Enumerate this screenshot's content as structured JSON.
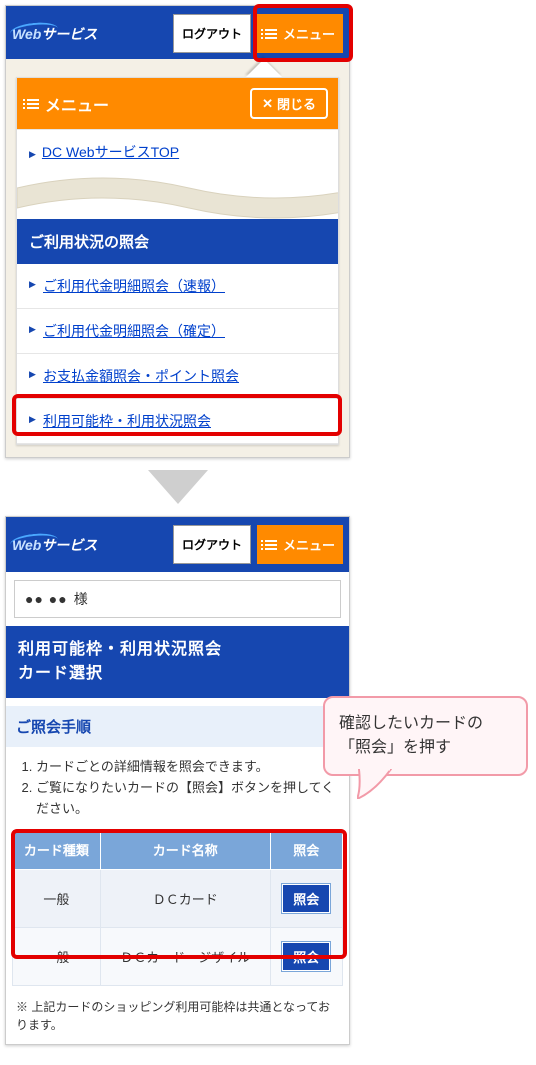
{
  "logo_web": "Web",
  "logo_svc": "サービス",
  "logout": "ログアウト",
  "menu": "メニュー",
  "close": "閉じる",
  "menu_top": "DC WebサービスTOP",
  "sec_usage": "ご利用状況の照会",
  "usage_links": [
    "ご利用代金明細照会（速報）",
    "ご利用代金明細照会（確定）",
    "お支払金額照会・ポイント照会",
    "利用可能枠・利用状況照会"
  ],
  "greet_suffix": "様",
  "page_title_l1": "利用可能枠・利用状況照会",
  "page_title_l2": "カード選択",
  "sub_title": "ご照会手順",
  "steps": [
    "カードごとの詳細情報を照会できます。",
    "ご覧になりたいカードの【照会】ボタンを押してください。"
  ],
  "th_type": "カード種類",
  "th_name": "カード名称",
  "th_inq": "照会",
  "rows": [
    {
      "type": "一般",
      "name": "ＤＣカード"
    },
    {
      "type": "一般",
      "name": "ＤＣカード　ジザイル"
    }
  ],
  "inquiry_btn": "照会",
  "note": "※ 上記カードのショッピング利用可能枠は共通となっております。",
  "callout_l1": "確認したいカードの",
  "callout_l2": "「照会」を押す"
}
